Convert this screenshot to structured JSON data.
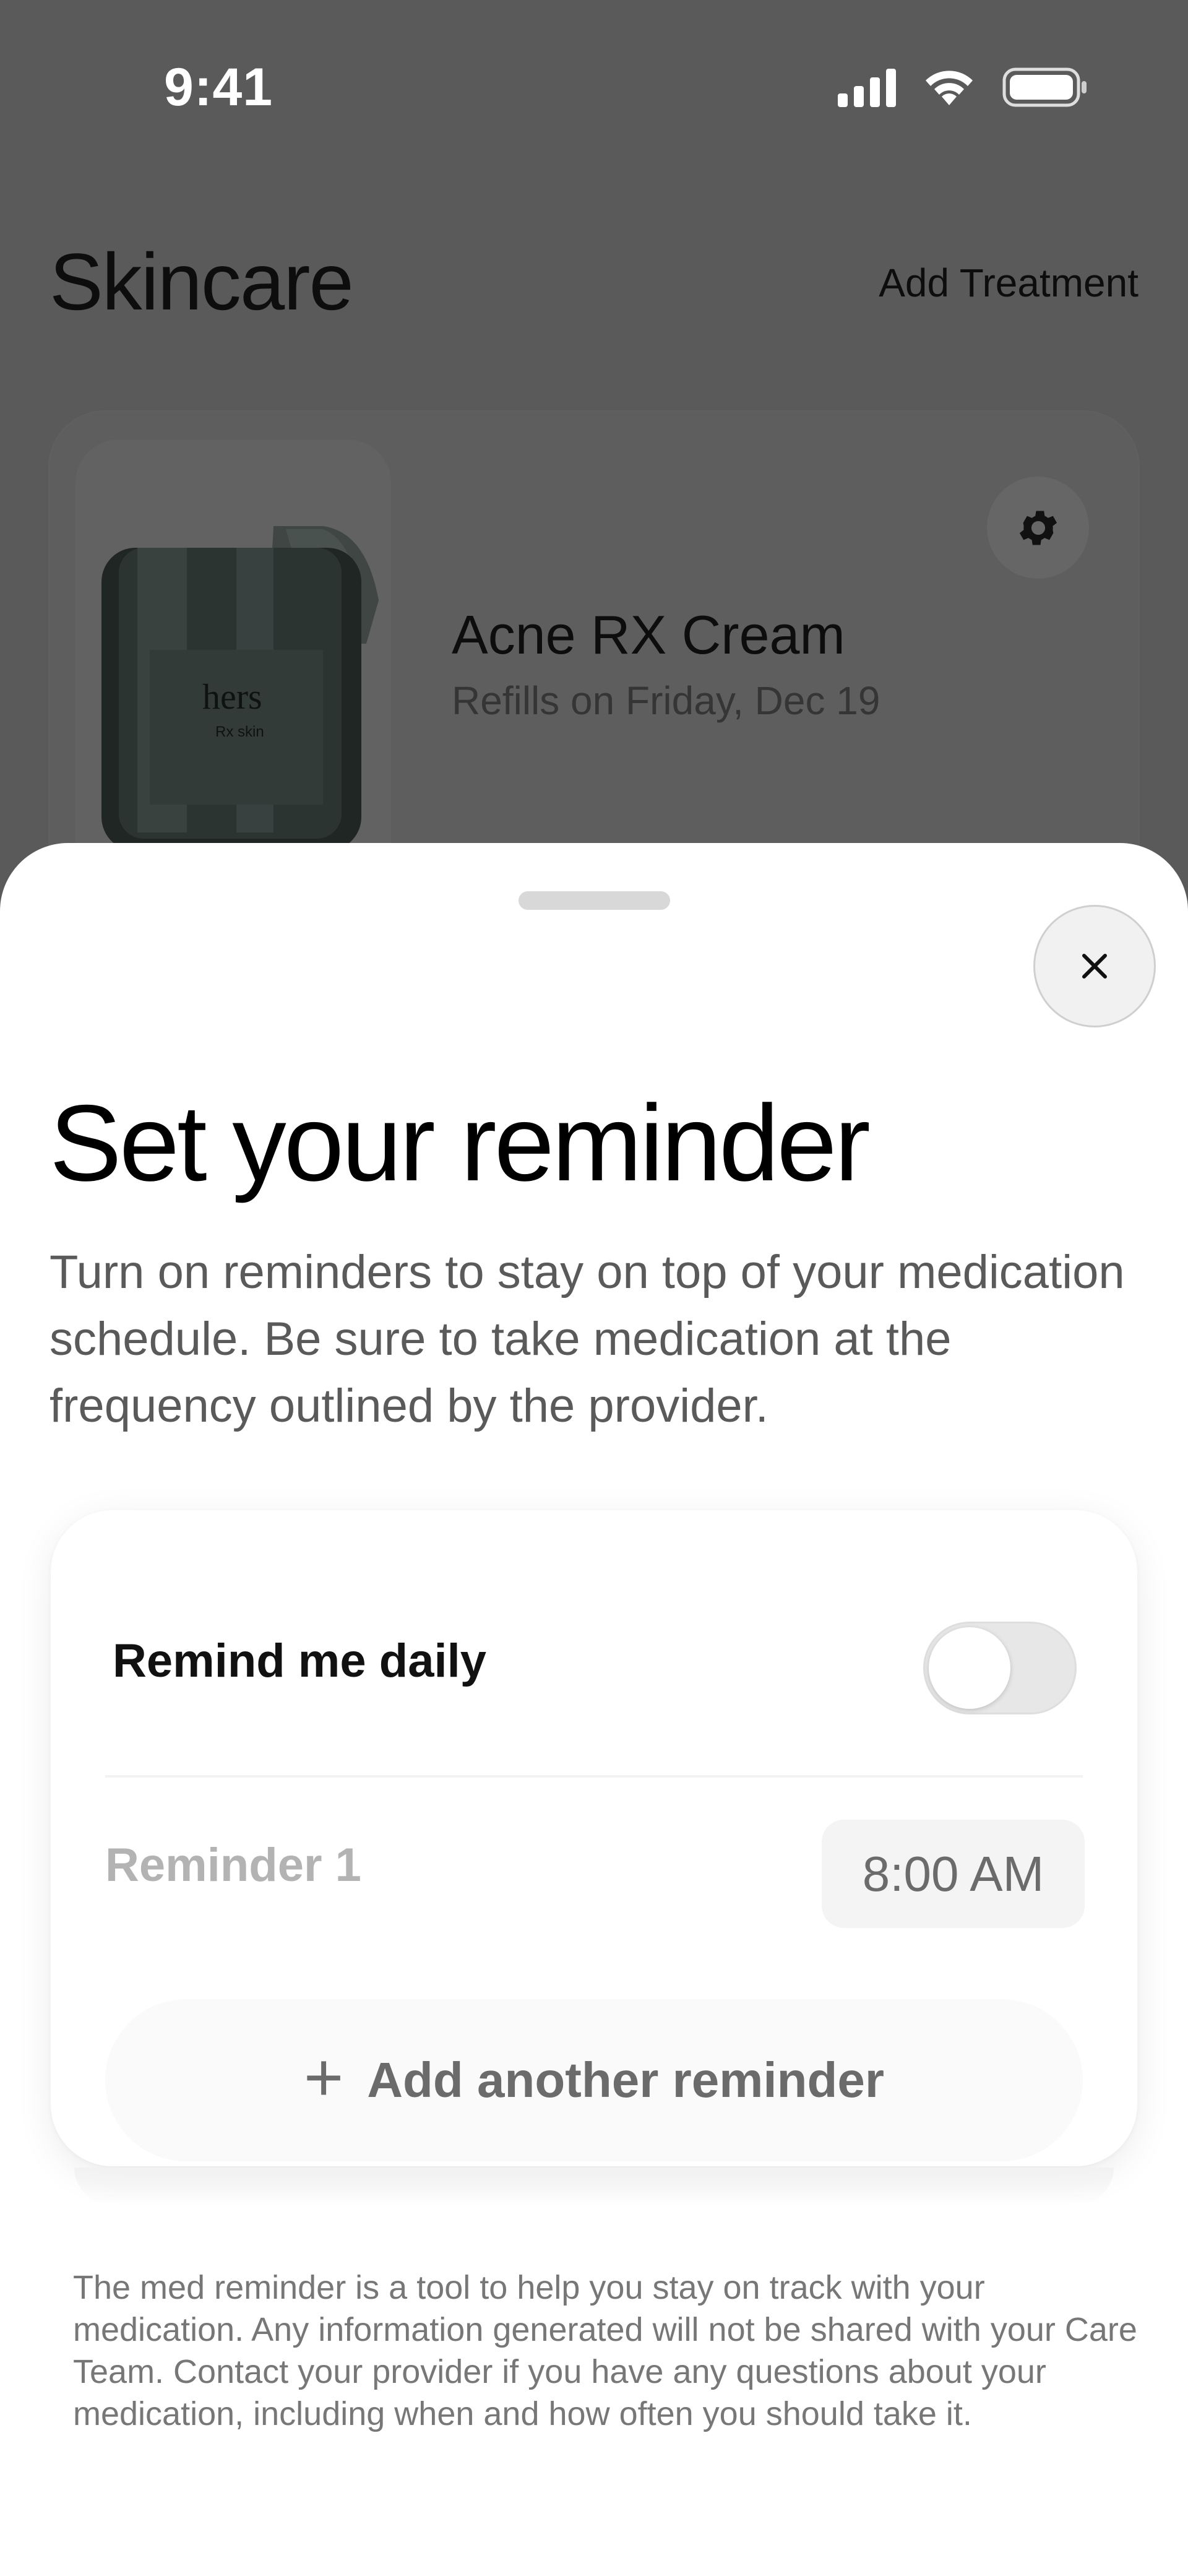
{
  "status_bar": {
    "time": "9:41",
    "icons": [
      "cellular-signal-icon",
      "wifi-icon",
      "battery-icon"
    ]
  },
  "background_screen": {
    "title": "Skincare",
    "add_treatment_label": "Add Treatment",
    "treatment_card": {
      "product_name": "Acne RX Cream",
      "refill_text": "Refills on Friday, Dec 19",
      "product_brand": "hers",
      "product_subtitle": "Rx skin",
      "settings_icon": "gear-icon"
    }
  },
  "sheet": {
    "close_icon": "close-icon",
    "title": "Set your reminder",
    "description": "Turn on reminders to stay on top of your medication schedule. Be sure to take medication at the frequency outlined by the provider.",
    "remind_daily_label": "Remind me daily",
    "remind_daily_enabled": false,
    "reminders": [
      {
        "label": "Reminder 1",
        "time": "8:00 AM"
      }
    ],
    "add_reminder_label": "Add another reminder",
    "disclaimer": "The med reminder is a tool to help you stay on track with your medication. Any information generated will not be shared with your Care Team. Contact your provider if you have any questions about your medication, including when and how often you should take it."
  },
  "colors": {
    "overlay": "#5a5a5a",
    "sheet_background": "#ffffff",
    "muted_text": "#5a5a5a",
    "disabled_text": "#b3b3b3"
  }
}
